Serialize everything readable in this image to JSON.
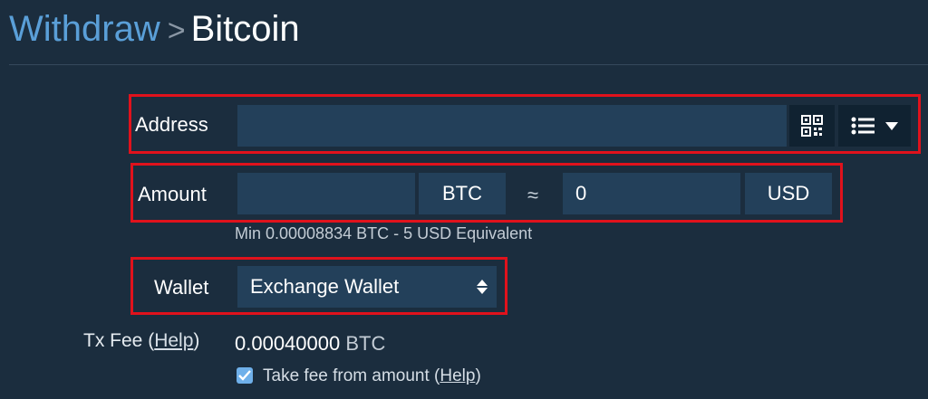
{
  "header": {
    "crumb": "Withdraw",
    "separator": ">",
    "current": "Bitcoin"
  },
  "address": {
    "label": "Address",
    "value": "",
    "qr_icon": "qr-code-icon",
    "list_icon": "list-icon",
    "dropdown_icon": "caret-down-icon"
  },
  "amount": {
    "label": "Amount",
    "btc_value": "",
    "btc_unit": "BTC",
    "approx": "≈",
    "usd_value": "0",
    "usd_unit": "USD",
    "hint": "Min 0.00008834 BTC - 5 USD Equivalent"
  },
  "wallet": {
    "label": "Wallet",
    "selected": "Exchange Wallet"
  },
  "fee": {
    "label": "Tx Fee",
    "help_open": "(",
    "help_link": "Help",
    "help_close": ")",
    "value": "0.00040000",
    "unit": "BTC",
    "checkbox_label": "Take fee from amount",
    "checkbox_checked": true
  },
  "colors": {
    "background": "#1b2d3e",
    "field": "#23405a",
    "accent": "#5a9fd8",
    "highlight_border": "#e0121c"
  }
}
